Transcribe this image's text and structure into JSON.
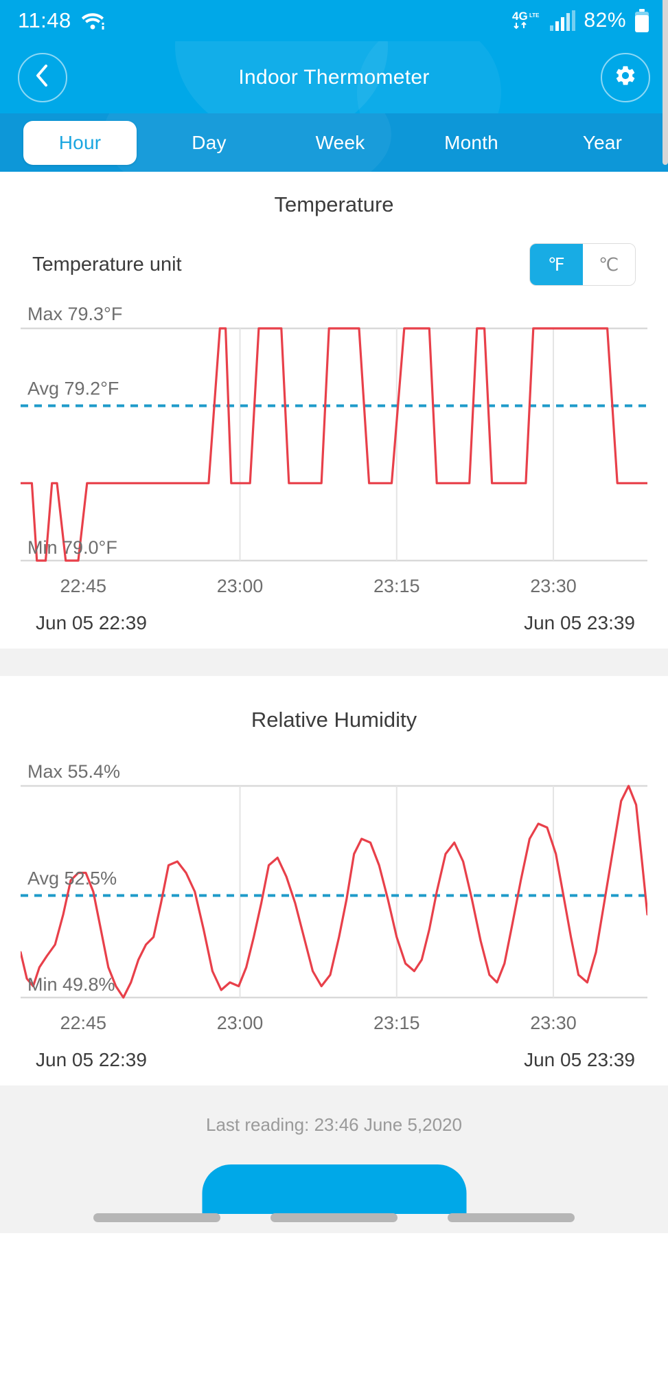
{
  "status_bar": {
    "time": "11:48",
    "wifi_icon": "wifi-icon",
    "network_icon": "4g-lte-icon",
    "signal_icon": "signal-bars-icon",
    "battery_percent": "82%",
    "battery_icon": "battery-icon"
  },
  "header": {
    "title": "Indoor Thermometer",
    "back_icon": "chevron-left-icon",
    "settings_icon": "gear-icon"
  },
  "tabs": [
    {
      "label": "Hour",
      "active": true
    },
    {
      "label": "Day",
      "active": false
    },
    {
      "label": "Week",
      "active": false
    },
    {
      "label": "Month",
      "active": false
    },
    {
      "label": "Year",
      "active": false
    }
  ],
  "temperature_card": {
    "title": "Temperature",
    "unit_label": "Temperature unit",
    "unit_options": [
      {
        "label": "℉",
        "selected": true
      },
      {
        "label": "℃",
        "selected": false
      }
    ],
    "max_label": "Max 79.3°F",
    "avg_label": "Avg 79.2°F",
    "min_label": "Min 79.0°F",
    "range_start": "Jun 05 22:39",
    "range_end": "Jun 05 23:39"
  },
  "humidity_card": {
    "title": "Relative Humidity",
    "max_label": "Max 55.4%",
    "avg_label": "Avg 52.5%",
    "min_label": "Min 49.8%",
    "range_start": "Jun 05 22:39",
    "range_end": "Jun 05 23:39"
  },
  "footer": {
    "last_reading": "Last reading: 23:46 June 5,2020"
  },
  "colors": {
    "brand_blue": "#00a8e8",
    "tabbar_blue": "#0d97d8",
    "series_red": "#e8404a",
    "avg_line_blue": "#1f9bc9",
    "grid_gray": "#d9d9d9",
    "text_dark": "#3c3c3c",
    "text_muted": "#6e6e6e"
  },
  "chart_data": [
    {
      "type": "line",
      "title": "Temperature",
      "xlabel": "",
      "ylabel": "°F",
      "ylim": [
        79.0,
        79.3
      ],
      "grid": true,
      "legend": "none",
      "max": 79.3,
      "avg": 79.2,
      "min": 79.0,
      "x_tick_labels": [
        "22:45",
        "23:00",
        "23:15",
        "23:30"
      ],
      "x_tick_positions": [
        0.1,
        0.35,
        0.6,
        0.85
      ],
      "range_start": "Jun 05 22:39",
      "range_end": "Jun 05 23:39",
      "series": [
        {
          "name": "Temperature",
          "color": "#e8404a",
          "units": "°F",
          "x": [
            0.0,
            0.018,
            0.026,
            0.04,
            0.05,
            0.058,
            0.072,
            0.082,
            0.092,
            0.106,
            0.118,
            0.13,
            0.142,
            0.156,
            0.17,
            0.186,
            0.205,
            0.225,
            0.25,
            0.275,
            0.3,
            0.318,
            0.327,
            0.336,
            0.345,
            0.355,
            0.366,
            0.38,
            0.396,
            0.406,
            0.416,
            0.428,
            0.452,
            0.468,
            0.48,
            0.492,
            0.504,
            0.52,
            0.54,
            0.556,
            0.566,
            0.578,
            0.592,
            0.612,
            0.628,
            0.64,
            0.652,
            0.664,
            0.682,
            0.7,
            0.716,
            0.728,
            0.74,
            0.752,
            0.772,
            0.792,
            0.806,
            0.818,
            0.83,
            0.845,
            0.862,
            0.88,
            0.898,
            0.912,
            0.924,
            0.936,
            0.952,
            0.966,
            0.98,
            1.0
          ],
          "y": [
            79.1,
            79.1,
            79.0,
            79.0,
            79.1,
            79.1,
            79.0,
            79.0,
            79.0,
            79.1,
            79.1,
            79.1,
            79.1,
            79.1,
            79.1,
            79.1,
            79.1,
            79.1,
            79.1,
            79.1,
            79.1,
            79.3,
            79.3,
            79.1,
            79.1,
            79.1,
            79.1,
            79.3,
            79.3,
            79.3,
            79.3,
            79.1,
            79.1,
            79.1,
            79.1,
            79.3,
            79.3,
            79.3,
            79.3,
            79.1,
            79.1,
            79.1,
            79.1,
            79.3,
            79.3,
            79.3,
            79.3,
            79.1,
            79.1,
            79.1,
            79.1,
            79.3,
            79.3,
            79.1,
            79.1,
            79.1,
            79.1,
            79.3,
            79.3,
            79.3,
            79.3,
            79.3,
            79.3,
            79.3,
            79.3,
            79.3,
            79.1,
            79.1,
            79.1,
            79.1
          ]
        }
      ]
    },
    {
      "type": "line",
      "title": "Relative Humidity",
      "xlabel": "",
      "ylabel": "%",
      "ylim": [
        49.8,
        55.4
      ],
      "grid": true,
      "legend": "none",
      "max": 55.4,
      "avg": 52.5,
      "min": 49.8,
      "x_tick_labels": [
        "22:45",
        "23:00",
        "23:15",
        "23:30"
      ],
      "x_tick_positions": [
        0.1,
        0.35,
        0.6,
        0.85
      ],
      "range_start": "Jun 05 22:39",
      "range_end": "Jun 05 23:39",
      "series": [
        {
          "name": "Relative Humidity",
          "color": "#e8404a",
          "units": "%",
          "x": [
            0.0,
            0.01,
            0.02,
            0.03,
            0.042,
            0.055,
            0.068,
            0.08,
            0.092,
            0.104,
            0.116,
            0.128,
            0.14,
            0.152,
            0.164,
            0.176,
            0.188,
            0.2,
            0.212,
            0.224,
            0.236,
            0.25,
            0.264,
            0.278,
            0.292,
            0.306,
            0.32,
            0.334,
            0.348,
            0.36,
            0.372,
            0.384,
            0.396,
            0.41,
            0.424,
            0.438,
            0.452,
            0.466,
            0.48,
            0.494,
            0.508,
            0.52,
            0.532,
            0.544,
            0.558,
            0.572,
            0.586,
            0.6,
            0.614,
            0.628,
            0.64,
            0.652,
            0.664,
            0.678,
            0.692,
            0.706,
            0.72,
            0.734,
            0.748,
            0.76,
            0.772,
            0.784,
            0.798,
            0.812,
            0.826,
            0.84,
            0.854,
            0.866,
            0.878,
            0.89,
            0.904,
            0.918,
            0.932,
            0.946,
            0.958,
            0.97,
            0.982,
            0.992,
            1.0
          ],
          "y": [
            51.0,
            50.3,
            50.1,
            50.6,
            50.9,
            51.2,
            52.0,
            52.9,
            53.1,
            53.1,
            52.6,
            51.6,
            50.6,
            50.1,
            49.8,
            50.2,
            50.8,
            51.2,
            51.4,
            52.3,
            53.3,
            53.4,
            53.1,
            52.6,
            51.6,
            50.5,
            50.0,
            50.2,
            50.1,
            50.6,
            51.4,
            52.3,
            53.3,
            53.5,
            53.0,
            52.3,
            51.4,
            50.5,
            50.1,
            50.4,
            51.4,
            52.4,
            53.6,
            54.0,
            53.9,
            53.3,
            52.4,
            51.4,
            50.7,
            50.5,
            50.8,
            51.6,
            52.6,
            53.6,
            53.9,
            53.4,
            52.4,
            51.3,
            50.4,
            50.2,
            50.7,
            51.7,
            52.9,
            54.0,
            54.4,
            54.3,
            53.6,
            52.5,
            51.4,
            50.4,
            50.2,
            51.0,
            52.4,
            53.8,
            55.0,
            55.4,
            54.9,
            53.3,
            52.0
          ]
        }
      ]
    }
  ]
}
